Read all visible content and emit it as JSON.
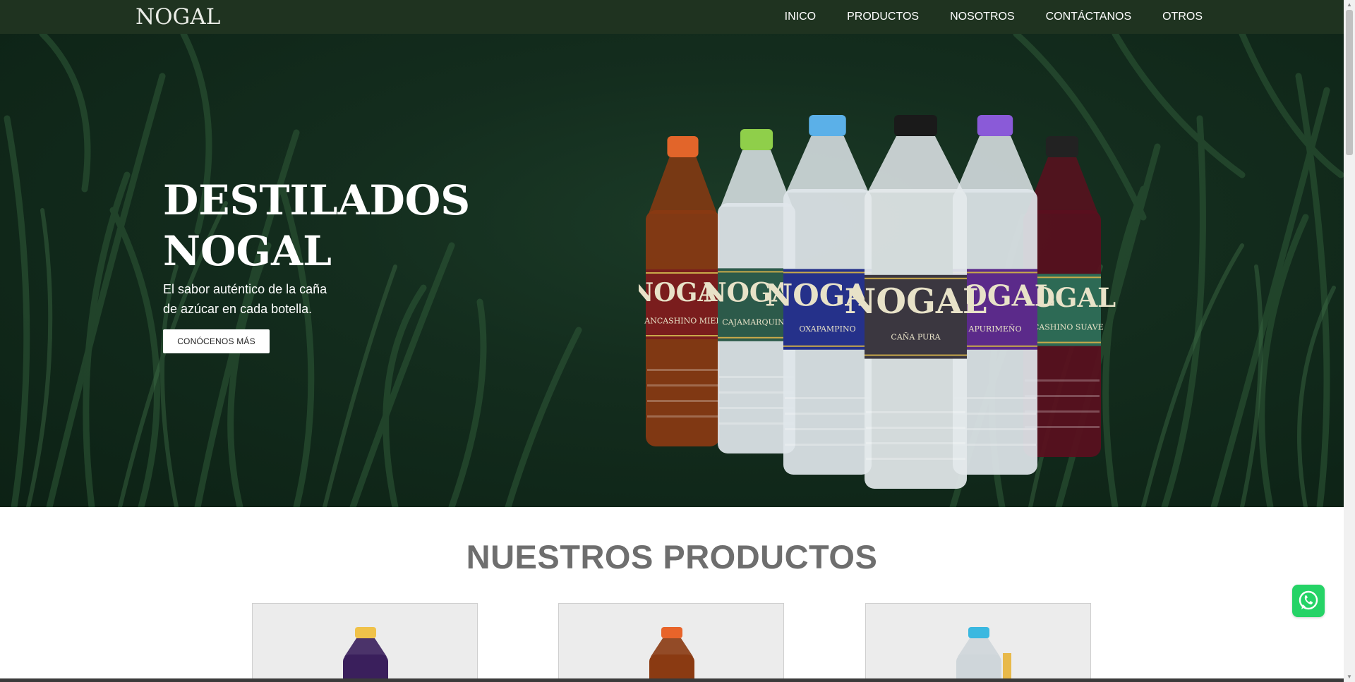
{
  "nav": {
    "brand": "NOGAL",
    "links": [
      "INICO",
      "PRODUCTOS",
      "NOSOTROS",
      "CONTÁCTANOS",
      "OTROS"
    ]
  },
  "hero": {
    "title_line1": "DESTILADOS",
    "title_line2": "NOGAL",
    "subtitle_line1": "El sabor auténtico de la caña",
    "subtitle_line2": "de azúcar en cada botella.",
    "button": "CONÓCENOS MÁS",
    "bottles": [
      {
        "cap": "#e2652a",
        "liquid": "#8a3a12",
        "label": "#7a1d1d",
        "brand": "NOGAL",
        "name": "ANCASHINO MIEL"
      },
      {
        "cap": "#8fcf4a",
        "liquid": "#dfe6ea",
        "label": "#2c5a4a",
        "brand": "NOGAL",
        "name": "CAJAMARQUINO"
      },
      {
        "cap": "#5bb0e8",
        "liquid": "#dfe6ea",
        "label": "#25318a",
        "brand": "NOGAL",
        "name": "OXAPAMPINO"
      },
      {
        "cap": "#1a1a1a",
        "liquid": "#e4e9ec",
        "label": "#3b3740",
        "brand": "NOGAL",
        "name": "CAÑA PURA"
      },
      {
        "cap": "#8a5ad8",
        "liquid": "#dfe6ea",
        "label": "#5b2a8a",
        "brand": "NOGAL",
        "name": "APURIMEÑO"
      },
      {
        "cap": "#222222",
        "liquid": "#5a0f1e",
        "label": "#2d6a55",
        "brand": "NOGAL",
        "name": "ANCASHINO SUAVE"
      }
    ]
  },
  "products": {
    "title": "NUESTROS PRODUCTOS",
    "cards": [
      {
        "cap": "#f0c24a",
        "liquid": "#3a1f5c"
      },
      {
        "cap": "#e8642a",
        "liquid": "#8a3a12"
      },
      {
        "cap": "#3ab8e0",
        "liquid": "#cfd6da"
      }
    ]
  },
  "colors": {
    "nav_bg": "#1f3320",
    "hero_bg": "#0f2a1a",
    "title_gray": "#6e6e6e",
    "whatsapp": "#25d366"
  }
}
